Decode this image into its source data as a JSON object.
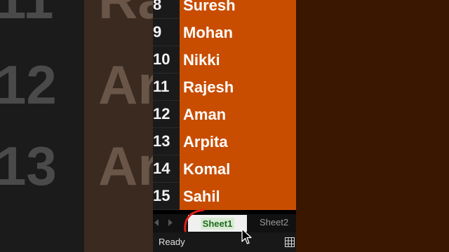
{
  "background": {
    "left_numbers": [
      "11",
      "12",
      "13"
    ],
    "left_names": [
      "Ra",
      "Ar",
      "Ar"
    ]
  },
  "rows": [
    {
      "num": "8",
      "name": "Suresh"
    },
    {
      "num": "9",
      "name": "Mohan"
    },
    {
      "num": "10",
      "name": "Nikki"
    },
    {
      "num": "11",
      "name": "Rajesh"
    },
    {
      "num": "12",
      "name": "Aman"
    },
    {
      "num": "13",
      "name": "Arpita"
    },
    {
      "num": "14",
      "name": "Komal"
    },
    {
      "num": "15",
      "name": "Sahil"
    }
  ],
  "tabs": {
    "active": "Sheet1",
    "other": "Sheet2"
  },
  "status": {
    "text": "Ready"
  },
  "colors": {
    "cell_fill": "#c84d00",
    "annotation": "#e0201a"
  },
  "icons": [
    "grid-view-icon",
    "mouse-pointer-icon",
    "sheet-prev-icon",
    "sheet-next-icon"
  ]
}
